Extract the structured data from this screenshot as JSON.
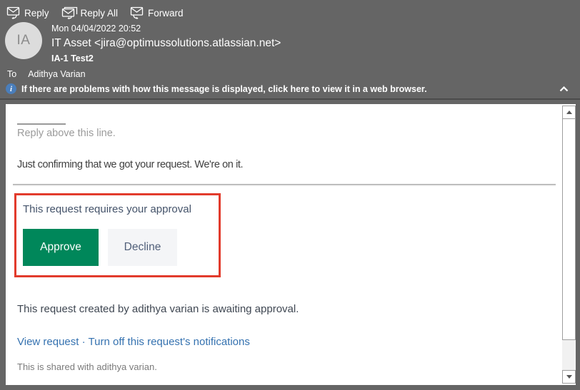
{
  "toolbar": {
    "reply_label": "Reply",
    "reply_all_label": "Reply All",
    "forward_label": "Forward"
  },
  "header": {
    "avatar_initials": "IA",
    "date": "Mon 04/04/2022 20:52",
    "sender": "IT Asset <jira@optimussolutions.atlassian.net>",
    "subject": "IA-1 Test2",
    "to_label": "To",
    "to_recipient": "Adithya Varian"
  },
  "info_bar": {
    "text": "If there are problems with how this message is displayed, click here to view it in a web browser."
  },
  "body": {
    "reply_above": "Reply above this line.",
    "confirmation": "Just confirming that we got your request. We're on it.",
    "approval": {
      "heading": "This request requires your approval",
      "approve_label": "Approve",
      "decline_label": "Decline"
    },
    "awaiting": "This request created by adithya varian is awaiting approval.",
    "links": {
      "view_request": "View request",
      "separator": "·",
      "turn_off": "Turn off this request's notifications"
    },
    "shared": "This is shared with adithya varian."
  },
  "icons": {
    "reply": "reply-icon",
    "reply_all": "reply-all-icon",
    "forward": "forward-icon",
    "info": "info-icon",
    "chevron_up": "chevron-up-icon",
    "scroll_up": "scroll-up-arrow-icon",
    "scroll_down": "scroll-down-arrow-icon"
  },
  "colors": {
    "header_bg": "#656565",
    "approve_green": "#00875A",
    "decline_bg": "#F4F5F7",
    "decline_text": "#505F79",
    "link_blue": "#3572B0",
    "annotation_red": "#E23B2C",
    "info_icon_blue": "#4A7EBB",
    "body_text": "#404040",
    "muted_text": "#9B9B9B"
  }
}
